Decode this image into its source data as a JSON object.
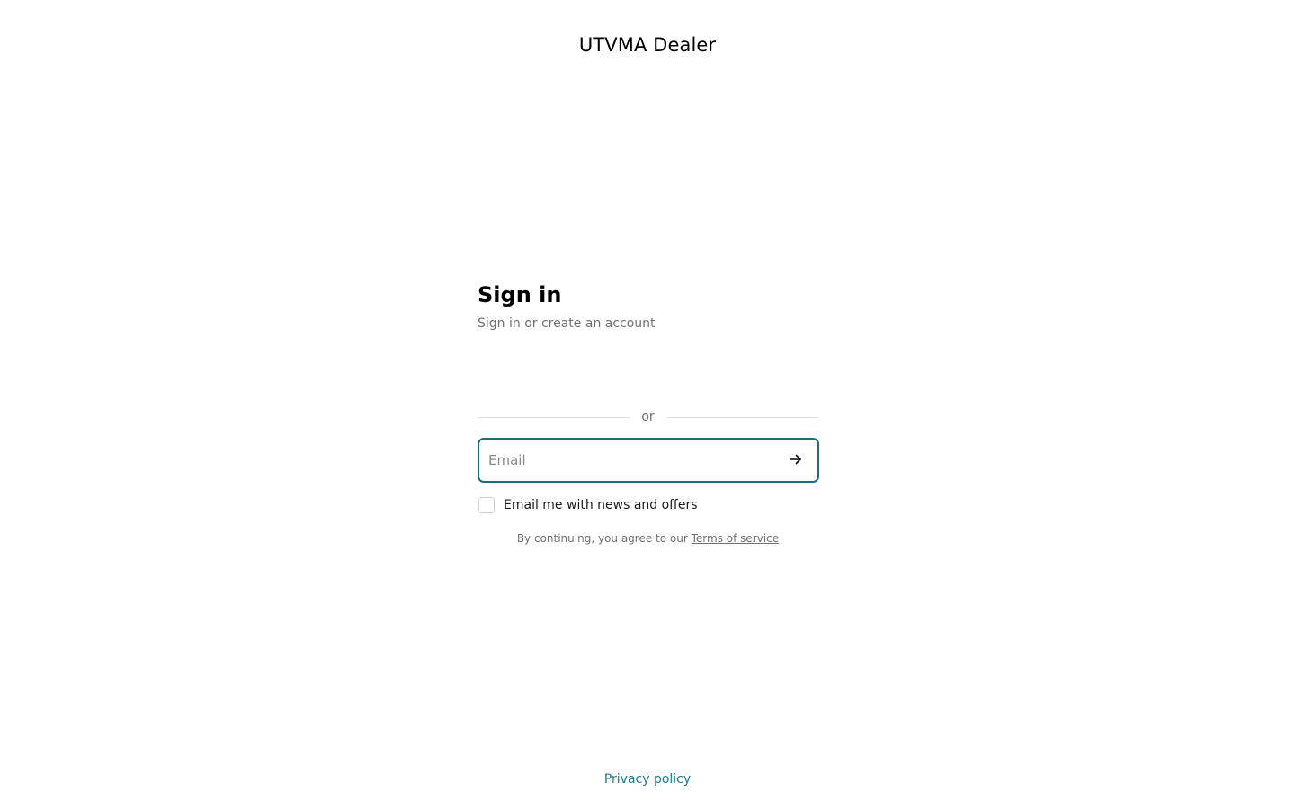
{
  "header": {
    "brand": "UTVMA Dealer"
  },
  "signin": {
    "title": "Sign in",
    "subtitle": "Sign in or create an account",
    "divider_text": "or",
    "email": {
      "value": "",
      "placeholder": "Email"
    },
    "submit_icon": "arrow-right-icon",
    "newsletter": {
      "label": "Email me with news and offers",
      "checked": false
    },
    "terms": {
      "prefix": "By continuing, you agree to our",
      "link_label": "Terms of service"
    }
  },
  "footer": {
    "privacy_label": "Privacy policy"
  },
  "colors": {
    "accent": "#1a6c7f",
    "link": "#1a7a92",
    "muted_text": "#707070",
    "divider": "#dedede"
  }
}
